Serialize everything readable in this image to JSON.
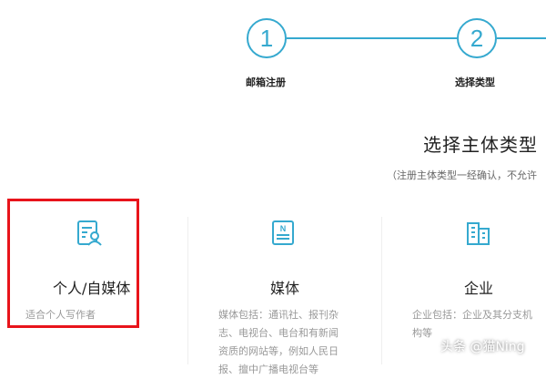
{
  "stepper": {
    "steps": [
      {
        "number": "1",
        "label": "邮箱注册"
      },
      {
        "number": "2",
        "label": "选择类型"
      }
    ]
  },
  "section": {
    "title": "选择主体类型",
    "note": "（注册主体类型一经确认，不允许"
  },
  "cards": [
    {
      "title": "个人/自媒体",
      "desc": "适合个人写作者",
      "icon": "person-document-icon"
    },
    {
      "title": "媒体",
      "desc_lines": [
        "媒体包括：通讯社、报刊杂",
        "志、电视台、电台和有新闻",
        "资质的网站等，例如人民日",
        "报、擅中广播电视台等"
      ],
      "icon": "newspaper-icon"
    },
    {
      "title": "企业",
      "desc_lines": [
        "企业包括：企业及其分支机",
        "构等"
      ],
      "icon": "building-icon"
    }
  ],
  "watermark": "头条 @猫Ning",
  "colors": {
    "accent": "#35a9cf",
    "highlight": "#e8141b"
  }
}
